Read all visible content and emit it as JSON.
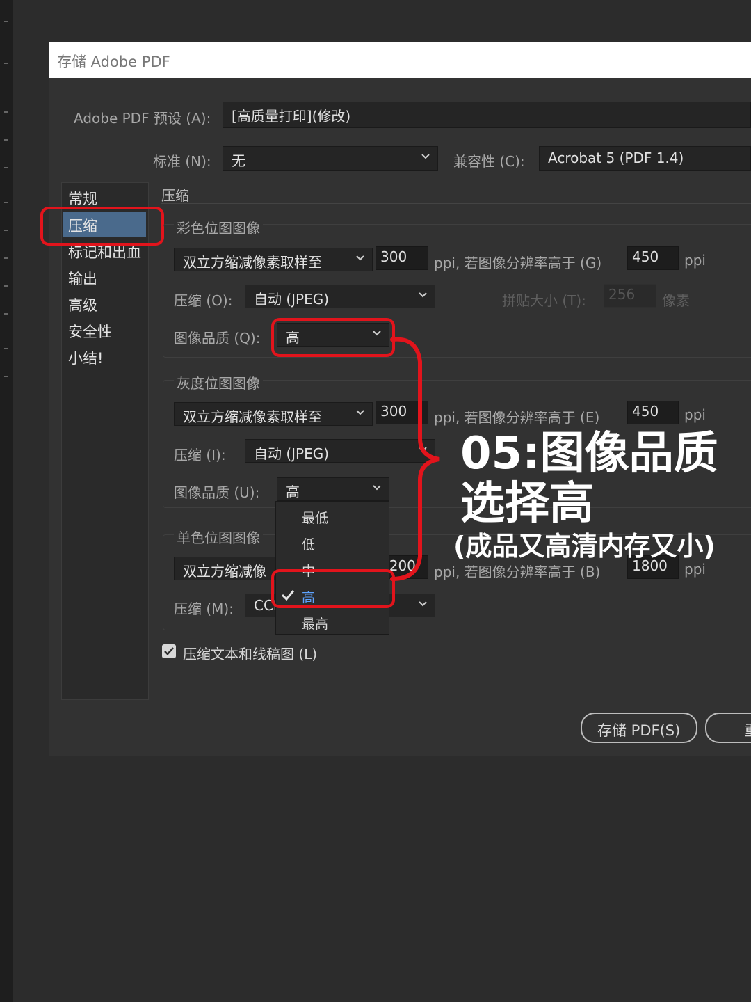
{
  "dialog": {
    "title": "存储 Adobe PDF"
  },
  "preset": {
    "label": "Adobe PDF 预设 (A):",
    "value": "[高质量打印](修改)"
  },
  "standard": {
    "label": "标准 (N):",
    "value": "无"
  },
  "compat": {
    "label": "兼容性 (C):",
    "value": "Acrobat 5 (PDF 1.4)"
  },
  "sidebar": {
    "items": [
      "常规",
      "压缩",
      "标记和出血",
      "输出",
      "高级",
      "安全性",
      "小结!"
    ],
    "selected": "压缩"
  },
  "section_title": "压缩",
  "color": {
    "title": "彩色位图图像",
    "sampling": "双立方缩减像素取样至",
    "ppi": "300",
    "unit": "ppi",
    "above_label": "ppi, 若图像分辨率高于 (G)",
    "above_ppi": "450",
    "above_unit": "ppi",
    "compress_label": "压缩 (O):",
    "compress": "自动 (JPEG)",
    "tile_label": "拼贴大小 (T):",
    "tile": "256",
    "tile_unit": "像素",
    "quality_label": "图像品质 (Q):",
    "quality": "高"
  },
  "gray": {
    "title": "灰度位图图像",
    "sampling": "双立方缩减像素取样至",
    "ppi": "300",
    "above_label": "ppi, 若图像分辨率高于 (E)",
    "above_ppi": "450",
    "above_unit": "ppi",
    "compress_label": "压缩 (I):",
    "compress": "自动 (JPEG)",
    "quality_label": "图像品质 (U):",
    "quality": "高"
  },
  "mono": {
    "title": "单色位图图像",
    "sampling": "双立方缩减像",
    "ppi": "1200",
    "above_label": "ppi, 若图像分辨率高于 (B)",
    "above_ppi": "1800",
    "above_unit": "ppi",
    "compress_label": "压缩 (M):",
    "compress": "CCITT"
  },
  "quality_menu": {
    "options": [
      "最低",
      "低",
      "中",
      "高",
      "最高"
    ],
    "checked": "高"
  },
  "compress_text": {
    "label": "压缩文本和线稿图 (L)",
    "checked": true
  },
  "buttons": {
    "save": "存储 PDF(S)",
    "cancel": "重"
  },
  "annotation": {
    "line1": "05:图像品质",
    "line2": "选择高",
    "line3": "(成品又高清内存又小)"
  },
  "colors": {
    "highlight": "#e2141c",
    "selection": "#4a6a8c",
    "menu_checked": "#5ea3ff"
  }
}
